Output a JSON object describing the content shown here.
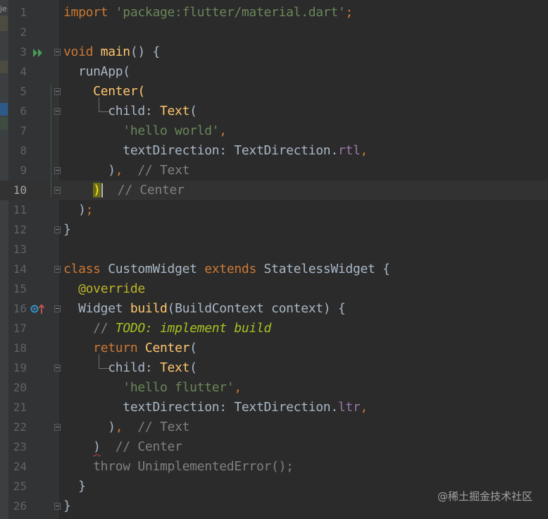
{
  "left_strip": {
    "label": "je"
  },
  "editor": {
    "current_line": 10,
    "lines": [
      {
        "n": "1",
        "tokens": [
          [
            "kw",
            "import "
          ],
          [
            "str",
            "'package:flutter/material.dart'"
          ],
          [
            "kw",
            ";"
          ]
        ]
      },
      {
        "n": "2",
        "tokens": []
      },
      {
        "n": "3",
        "tokens": [
          [
            "kw",
            "void "
          ],
          [
            "fn",
            "main"
          ],
          [
            "ty",
            "() {"
          ]
        ]
      },
      {
        "n": "4",
        "tokens": [
          [
            "ty",
            "  runApp("
          ]
        ]
      },
      {
        "n": "5",
        "tokens": [
          [
            "ty",
            "    "
          ],
          [
            "fn",
            "Center"
          ],
          [
            "fn",
            "("
          ]
        ]
      },
      {
        "n": "6",
        "tokens": [
          [
            "ty",
            "      child: "
          ],
          [
            "fn",
            "Text"
          ],
          [
            "ty",
            "("
          ]
        ]
      },
      {
        "n": "7",
        "tokens": [
          [
            "ty",
            "        "
          ],
          [
            "str",
            "'hello world'"
          ],
          [
            "kw",
            ","
          ]
        ]
      },
      {
        "n": "8",
        "tokens": [
          [
            "ty",
            "        textDirection: TextDirection."
          ],
          [
            "prop",
            "rtl"
          ],
          [
            "kw",
            ","
          ]
        ]
      },
      {
        "n": "9",
        "tokens": [
          [
            "ty",
            "      )"
          ],
          [
            "kw",
            ","
          ],
          [
            "cm",
            "  // Text"
          ]
        ]
      },
      {
        "n": "10",
        "tokens": [
          [
            "ty",
            "    "
          ],
          [
            "hly",
            ")"
          ],
          [
            "caret",
            ""
          ],
          [
            "cm",
            "  // Center"
          ]
        ]
      },
      {
        "n": "11",
        "tokens": [
          [
            "ty",
            "  )"
          ],
          [
            "kw",
            ";"
          ]
        ]
      },
      {
        "n": "12",
        "tokens": [
          [
            "ty",
            "}"
          ]
        ]
      },
      {
        "n": "13",
        "tokens": []
      },
      {
        "n": "14",
        "tokens": [
          [
            "kw",
            "class "
          ],
          [
            "ty",
            "CustomWidget "
          ],
          [
            "kw",
            "extends "
          ],
          [
            "ty",
            "StatelessWidget {"
          ]
        ]
      },
      {
        "n": "15",
        "tokens": [
          [
            "ty",
            "  "
          ],
          [
            "ann",
            "@override"
          ]
        ]
      },
      {
        "n": "16",
        "tokens": [
          [
            "ty",
            "  Widget "
          ],
          [
            "fn",
            "build"
          ],
          [
            "ty",
            "(BuildContext context) {"
          ]
        ]
      },
      {
        "n": "17",
        "tokens": [
          [
            "ty",
            "    "
          ],
          [
            "cm",
            "// "
          ],
          [
            "todo",
            "TODO: implement build"
          ]
        ]
      },
      {
        "n": "18",
        "tokens": [
          [
            "ty",
            "    "
          ],
          [
            "kw",
            "return "
          ],
          [
            "fn",
            "Center"
          ],
          [
            "ty",
            "("
          ]
        ]
      },
      {
        "n": "19",
        "tokens": [
          [
            "ty",
            "      child: "
          ],
          [
            "fn",
            "Text"
          ],
          [
            "ty",
            "("
          ]
        ]
      },
      {
        "n": "20",
        "tokens": [
          [
            "ty",
            "        "
          ],
          [
            "str",
            "'hello flutter'"
          ],
          [
            "kw",
            ","
          ]
        ]
      },
      {
        "n": "21",
        "tokens": [
          [
            "ty",
            "        textDirection: TextDirection."
          ],
          [
            "prop",
            "ltr"
          ],
          [
            "kw",
            ","
          ]
        ]
      },
      {
        "n": "22",
        "tokens": [
          [
            "ty",
            "      )"
          ],
          [
            "kw",
            ","
          ],
          [
            "cm",
            "  // Text"
          ]
        ]
      },
      {
        "n": "23",
        "tokens": [
          [
            "ty",
            "    "
          ],
          [
            "sq",
            ")"
          ],
          [
            "cm",
            "  // Center"
          ]
        ]
      },
      {
        "n": "24",
        "tokens": [
          [
            "cm",
            "    throw UnimplementedError();"
          ]
        ]
      },
      {
        "n": "25",
        "tokens": [
          [
            "ty",
            "  }"
          ]
        ]
      },
      {
        "n": "26",
        "tokens": [
          [
            "ty",
            "}"
          ]
        ]
      }
    ]
  },
  "gutter_icons": {
    "run": "run-gutter-icon",
    "override": "override-gutter-icon"
  },
  "watermark": "@稀土掘金技术社区",
  "colors": {
    "background": "#2b2b2b",
    "gutter": "#313335",
    "keyword": "#cc7832",
    "string": "#6a8759",
    "function": "#ffc66d",
    "property": "#9876aa",
    "comment": "#808080",
    "todo": "#a8c023",
    "annotation": "#bbb529"
  }
}
